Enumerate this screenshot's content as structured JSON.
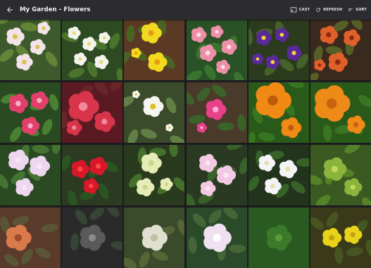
{
  "appbar": {
    "back_icon": "arrow-back-icon",
    "title": "My Garden - Flowers",
    "actions": [
      {
        "label": "CAST",
        "icon": "cast-icon"
      },
      {
        "label": "REFRESH",
        "icon": "refresh-icon"
      },
      {
        "label": "SORT",
        "icon": "sort-icon"
      }
    ]
  },
  "photos": [
    {
      "bg": "#3c5a2c",
      "petal": "#f3e4ea",
      "center": "#d8c24a",
      "leaf": "#6a8c3a"
    },
    {
      "bg": "#2e4a22",
      "petal": "#f4f4ee",
      "center": "#e5d97a",
      "leaf": "#4f7a2e"
    },
    {
      "bg": "#5a3a24",
      "petal": "#f2d81e",
      "center": "#e59b12",
      "leaf": "#4a6a26"
    },
    {
      "bg": "#2a5226",
      "petal": "#ee8fa8",
      "center": "#ffe0ea",
      "leaf": "#3c7a30"
    },
    {
      "bg": "#2c3a1e",
      "petal": "#5a2a9a",
      "center": "#f0d23c",
      "leaf": "#4a6a2a"
    },
    {
      "bg": "#3a2a1e",
      "petal": "#e0602a",
      "center": "#8a2a14",
      "leaf": "#5a6a2a"
    },
    {
      "bg": "#2a4a22",
      "petal": "#e2406a",
      "center": "#f2b0c6",
      "leaf": "#4f8a34"
    },
    {
      "bg": "#5a1a22",
      "petal": "#d8344a",
      "center": "#f08a9a",
      "leaf": "#6a2a2a"
    },
    {
      "bg": "#3a4a2a",
      "petal": "#f6f6f0",
      "center": "#e0c020",
      "leaf": "#6a8a4a"
    },
    {
      "bg": "#4a3a2a",
      "petal": "#e8408a",
      "center": "#ffb0d0",
      "leaf": "#3a6a2a"
    },
    {
      "bg": "#2a5a1a",
      "petal": "#f08a14",
      "center": "#c05a0a",
      "leaf": "#3a7a22"
    },
    {
      "bg": "#2a5a1a",
      "petal": "#ee8a18",
      "center": "#c8620c",
      "leaf": "#3c7a24"
    },
    {
      "bg": "#2a4a22",
      "petal": "#eed6ee",
      "center": "#f6e6f2",
      "leaf": "#4a7a34"
    },
    {
      "bg": "#2c3a22",
      "petal": "#d81828",
      "center": "#ff4a4a",
      "leaf": "#2a5a22"
    },
    {
      "bg": "#2a3a1e",
      "petal": "#e6ecb6",
      "center": "#c8d68a",
      "leaf": "#4a7a2e"
    },
    {
      "bg": "#2a3a22",
      "petal": "#f2c8e2",
      "center": "#fae6f2",
      "leaf": "#3a6a2a"
    },
    {
      "bg": "#22351c",
      "petal": "#f4f4f6",
      "center": "#e6e0b0",
      "leaf": "#3a6a2a"
    },
    {
      "bg": "#3a5a22",
      "petal": "#8ab43c",
      "center": "#c2d85a",
      "leaf": "#5a8a2a"
    },
    {
      "bg": "#5a3a2a",
      "petal": "#d87a4a",
      "center": "#a04a2a",
      "leaf": "#5a5a3a"
    },
    {
      "bg": "#2a2a2a",
      "petal": "#5a5a5a",
      "center": "#8a8a8a",
      "leaf": "#3a4a3a"
    },
    {
      "bg": "#3a4a2a",
      "petal": "#e0e0d0",
      "center": "#c0c0a0",
      "leaf": "#5a6a3a"
    },
    {
      "bg": "#2a4a2a",
      "petal": "#f0e0f0",
      "center": "#ffffff",
      "leaf": "#4a6a3a"
    },
    {
      "bg": "#2a5a22",
      "petal": "#3a7a2a",
      "center": "#5a9a3a",
      "leaf": "#2a5a22"
    },
    {
      "bg": "#3a3a1a",
      "petal": "#e8d21a",
      "center": "#c0a010",
      "leaf": "#4a5a22"
    }
  ]
}
